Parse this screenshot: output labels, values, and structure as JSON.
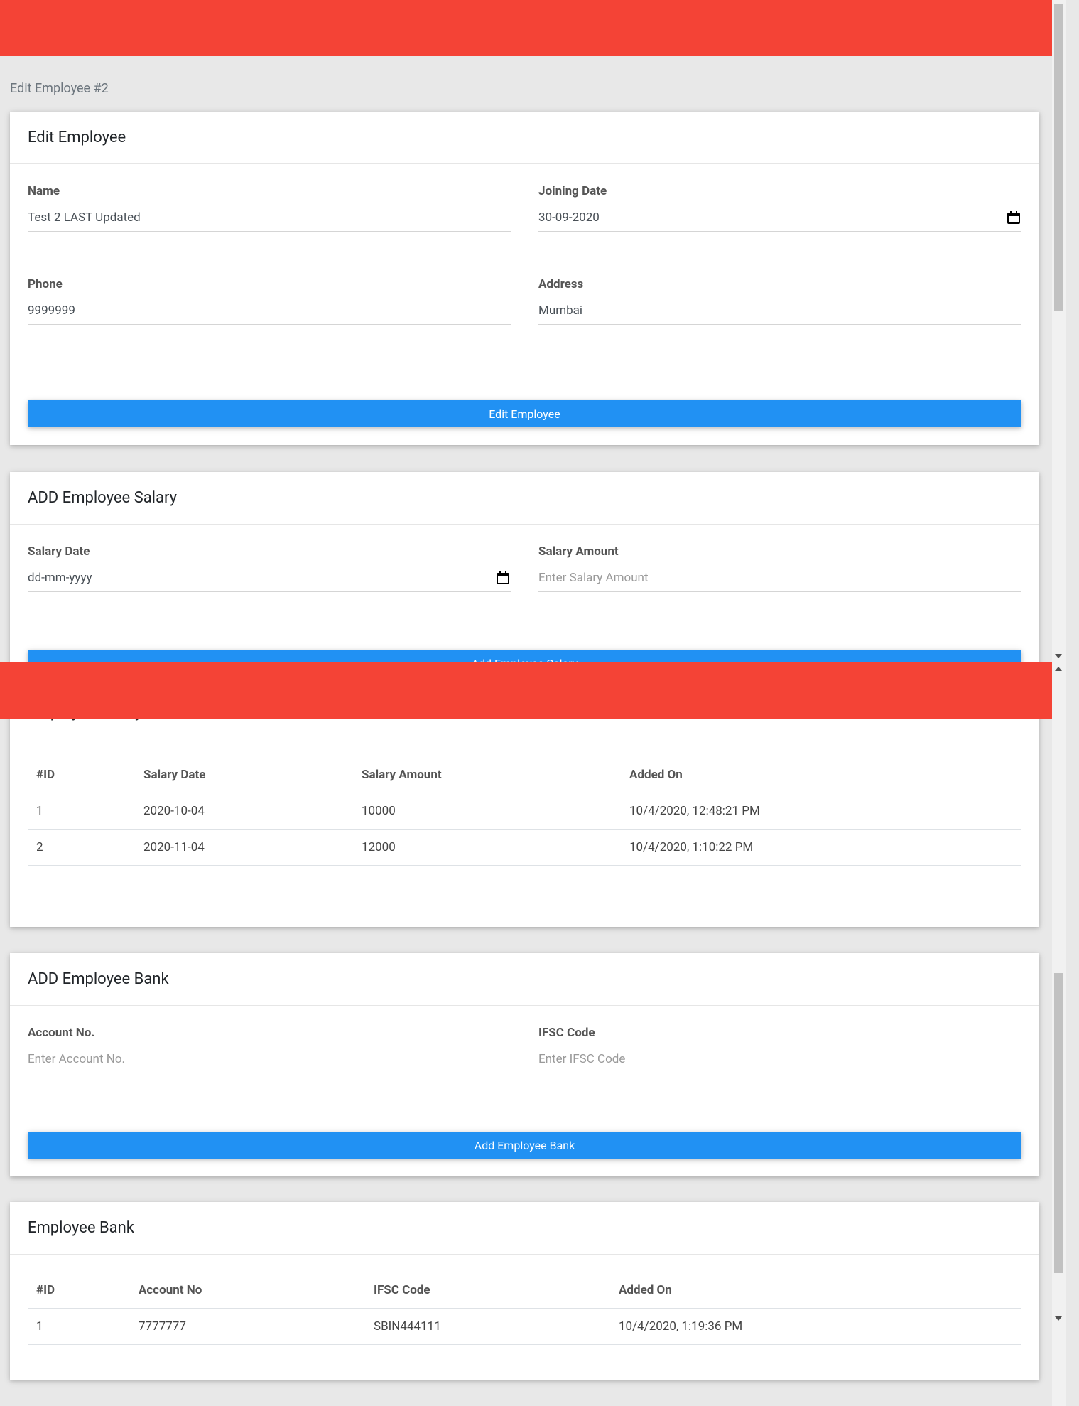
{
  "breadcrumb": "Edit Employee #2",
  "edit_employee": {
    "title": "Edit Employee",
    "name_label": "Name",
    "name_value": "Test 2 LAST Updated",
    "joining_date_label": "Joining Date",
    "joining_date_value": "30-09-2020",
    "phone_label": "Phone",
    "phone_value": "9999999",
    "address_label": "Address",
    "address_value": "Mumbai",
    "button_label": "Edit Employee"
  },
  "add_salary": {
    "title": "ADD Employee Salary",
    "salary_date_label": "Salary Date",
    "salary_date_value": "dd-mm-yyyy",
    "salary_amount_label": "Salary Amount",
    "salary_amount_placeholder": "Enter Salary Amount",
    "button_label": "Add Employee Salary"
  },
  "employee_salary": {
    "title": "Employee Salary",
    "headers": [
      "#ID",
      "Salary Date",
      "Salary Amount",
      "Added On"
    ],
    "rows": [
      [
        "1",
        "2020-10-04",
        "10000",
        "10/4/2020, 12:48:21 PM"
      ],
      [
        "2",
        "2020-11-04",
        "12000",
        "10/4/2020, 1:10:22 PM"
      ]
    ]
  },
  "add_bank": {
    "title": "ADD Employee Bank",
    "account_label": "Account No.",
    "account_placeholder": "Enter Account No.",
    "ifsc_label": "IFSC Code",
    "ifsc_placeholder": "Enter IFSC Code",
    "button_label": "Add Employee Bank"
  },
  "employee_bank": {
    "title": "Employee Bank",
    "headers": [
      "#ID",
      "Account No",
      "IFSC Code",
      "Added On"
    ],
    "rows": [
      [
        "1",
        "7777777",
        "SBIN444111",
        "10/4/2020, 1:19:36 PM"
      ]
    ]
  },
  "colors": {
    "navbar": "#f44336",
    "primary_button": "#2191f3",
    "background": "#e8e8e8"
  },
  "icons": [
    "calendar-icon",
    "scroll-up-arrow",
    "scroll-down-arrow"
  ]
}
